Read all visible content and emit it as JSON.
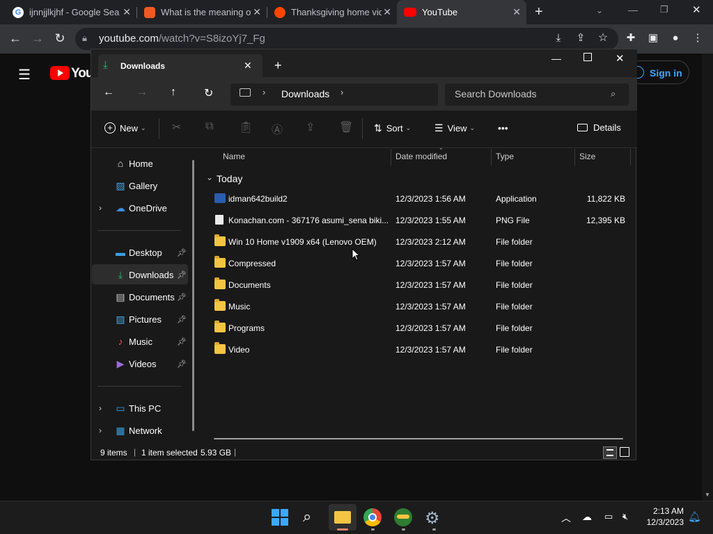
{
  "chrome": {
    "tabs": [
      {
        "title": "ijnnjjlkjhf - Google Sear",
        "fav_color": "#4285f4"
      },
      {
        "title": "What is the meaning of",
        "fav_color": "#ef5a24"
      },
      {
        "title": "Thanksgiving home vid",
        "fav_color": "#ff4500"
      },
      {
        "title": "YouTube",
        "fav_color": "#ff0000"
      }
    ],
    "url_main": "youtube.com",
    "url_rest": "/watch?v=S8izoYj7_Fg"
  },
  "youtube": {
    "logo_text": "You",
    "sign_in": "Sign in"
  },
  "explorer": {
    "tab_title": "Downloads",
    "breadcrumb": "Downloads",
    "search_placeholder": "Search Downloads",
    "cmd": {
      "new": "New",
      "sort": "Sort",
      "view": "View",
      "more": "•••",
      "details": "Details"
    },
    "sidebar": {
      "home": "Home",
      "gallery": "Gallery",
      "onedrive": "OneDrive",
      "desktop": "Desktop",
      "downloads": "Downloads",
      "documents": "Documents",
      "pictures": "Pictures",
      "music": "Music",
      "videos": "Videos",
      "thispc": "This PC",
      "network": "Network"
    },
    "columns": {
      "name": "Name",
      "date": "Date modified",
      "type": "Type",
      "size": "Size"
    },
    "group": "Today",
    "files": [
      {
        "name": "idman642build2",
        "date": "12/3/2023 1:56 AM",
        "type": "Application",
        "size": "11,822 KB"
      },
      {
        "name": "Konachan.com - 367176 asumi_sena biki...",
        "date": "12/3/2023 1:55 AM",
        "type": "PNG File",
        "size": "12,395 KB"
      },
      {
        "name": "Win 10 Home v1909 x64 (Lenovo OEM)",
        "date": "12/3/2023 2:12 AM",
        "type": "File folder",
        "size": ""
      },
      {
        "name": "Compressed",
        "date": "12/3/2023 1:57 AM",
        "type": "File folder",
        "size": ""
      },
      {
        "name": "Documents",
        "date": "12/3/2023 1:57 AM",
        "type": "File folder",
        "size": ""
      },
      {
        "name": "Music",
        "date": "12/3/2023 1:57 AM",
        "type": "File folder",
        "size": ""
      },
      {
        "name": "Programs",
        "date": "12/3/2023 1:57 AM",
        "type": "File folder",
        "size": ""
      },
      {
        "name": "Video",
        "date": "12/3/2023 1:57 AM",
        "type": "File folder",
        "size": ""
      }
    ],
    "status": {
      "items": "9 items",
      "selected": "1 item selected",
      "size": "5.93 GB"
    }
  },
  "taskbar": {
    "time": "2:13 AM",
    "date": "12/3/2023"
  }
}
